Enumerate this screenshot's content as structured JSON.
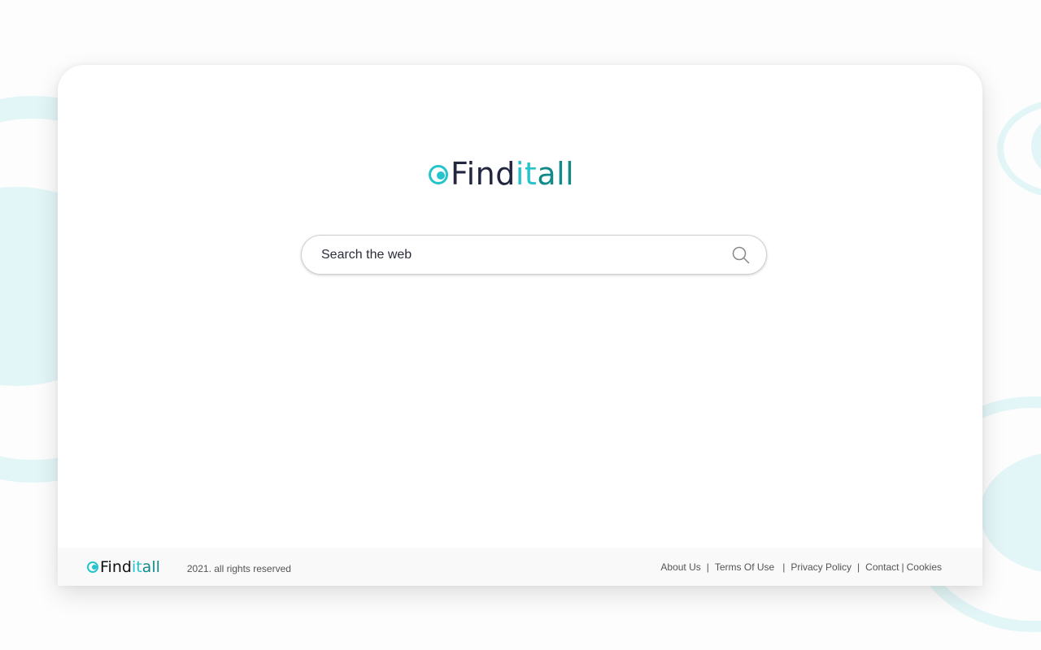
{
  "brand": {
    "name_part1": "Find",
    "name_part2": "it",
    "name_part3": "all",
    "colors": {
      "dark": "#22263f",
      "accent": "#25c4cc",
      "teal": "#128a8a"
    }
  },
  "search": {
    "placeholder": "Search the web",
    "value": "",
    "icon": "search-icon"
  },
  "footer": {
    "copyright": "2021. all rights reserved",
    "links": [
      "About Us",
      "Terms Of Use",
      "Privacy Policy",
      "Contact",
      "Cookies"
    ],
    "separator": "|"
  }
}
